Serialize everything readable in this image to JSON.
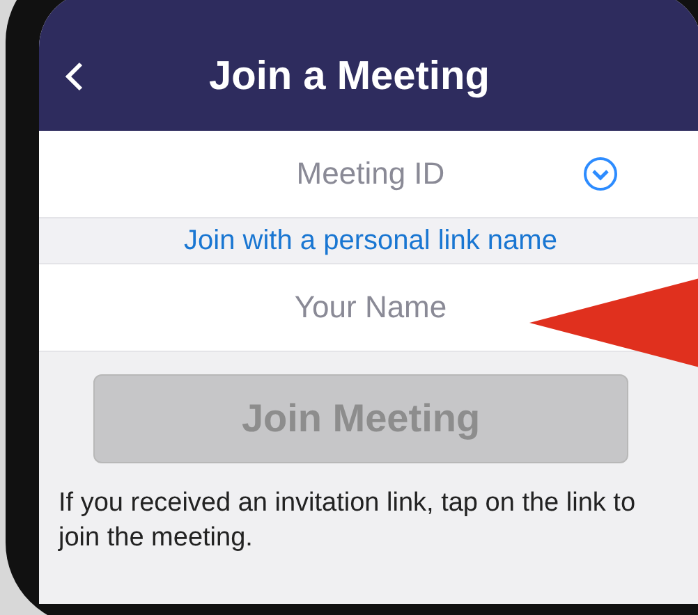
{
  "header": {
    "title": "Join a Meeting"
  },
  "meeting_id": {
    "placeholder": "Meeting ID"
  },
  "personal_link": "Join with a personal link name",
  "name_field": {
    "placeholder": "Your Name"
  },
  "join_button": {
    "label": "Join Meeting",
    "disabled": true
  },
  "note": "If you received an invitation link, tap on the link to join the meeting."
}
